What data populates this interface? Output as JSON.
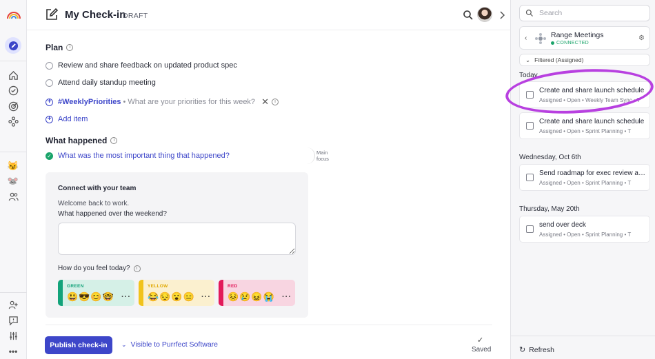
{
  "header": {
    "title": "My Check-in",
    "status": "DRAFT"
  },
  "plan": {
    "title": "Plan",
    "items": [
      "Review and share feedback on updated product spec",
      "Attend daily standup meeting"
    ],
    "priority_tag": "#WeeklyPriorities",
    "priority_prompt": "• What are your priorities for this week?",
    "add_item": "Add item"
  },
  "happened": {
    "title": "What happened",
    "question": "What was the most important thing that happened?",
    "main_focus": "Main focus"
  },
  "connect": {
    "title": "Connect with your team",
    "welcome": "Welcome back to work.",
    "question": "What happened over the weekend?",
    "feel_question": "How do you feel today?",
    "moods": [
      {
        "label": "GREEN",
        "faces": "😃😎😊🤓",
        "color": "#12a37a",
        "bg": "#d5f0e7"
      },
      {
        "label": "YELLOW",
        "faces": "😂😔😮😑",
        "color": "#f1c31b",
        "bg": "#fbf0cf"
      },
      {
        "label": "RED",
        "faces": "😣😢😖😭",
        "color": "#e2195a",
        "bg": "#f8d5e1"
      }
    ]
  },
  "footer": {
    "publish": "Publish check-in",
    "visibility": "Visible to Purrfect Software",
    "saved": "Saved"
  },
  "panel": {
    "search_placeholder": "Search",
    "source_name": "Range Meetings",
    "source_status": "CONNECTED",
    "filter": "Filtered (Assigned)",
    "groups": [
      {
        "heading": "Today",
        "tasks": [
          {
            "title": "Create and share launch schedule",
            "meta": "Assigned • Open • Weekly Team Sync • T"
          },
          {
            "title": "Create and share launch schedule",
            "meta": "Assigned • Open • Sprint Planning • T"
          }
        ]
      },
      {
        "heading": "Wednesday, Oct 6th",
        "tasks": [
          {
            "title": "Send roadmap for exec review and",
            "meta": "Assigned • Open • Sprint Planning • T"
          }
        ]
      },
      {
        "heading": "Thursday, May 20th",
        "tasks": [
          {
            "title": "send over deck",
            "meta": "Assigned • Open • Sprint Planning • T"
          }
        ]
      }
    ],
    "refresh": "Refresh"
  },
  "colors": {
    "accent": "#3d46c9",
    "success": "#1aa46a",
    "annotation": "#b840e0"
  }
}
